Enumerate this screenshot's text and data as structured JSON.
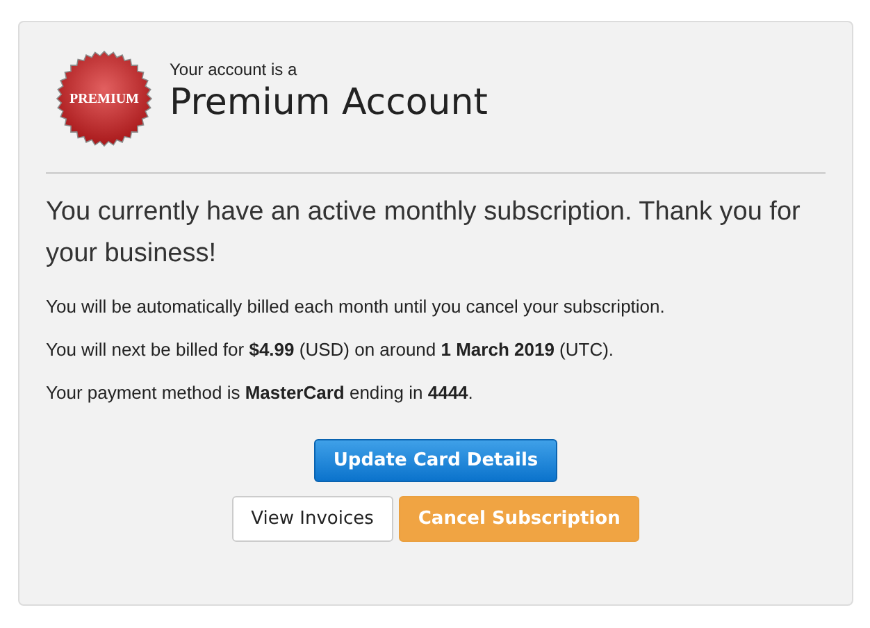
{
  "badge": {
    "label": "PREMIUM"
  },
  "intro": "Your account is a",
  "title": "Premium Account",
  "lead": "You currently have an active monthly subscription. Thank you for your business!",
  "details": [
    "You will be automatically billed each month until you cancel your subscription.",
    "You will next be billed for **$4.99** (USD) on around **1 March 2019** (UTC).",
    "Your payment method is **MasterCard** ending in **4444**."
  ],
  "button_rows": [
    [
      {
        "label": "Update Card Details",
        "kind": "primary"
      }
    ],
    [
      {
        "label": "View Invoices",
        "kind": "default"
      },
      {
        "label": "Cancel Subscription",
        "kind": "warning"
      }
    ]
  ]
}
